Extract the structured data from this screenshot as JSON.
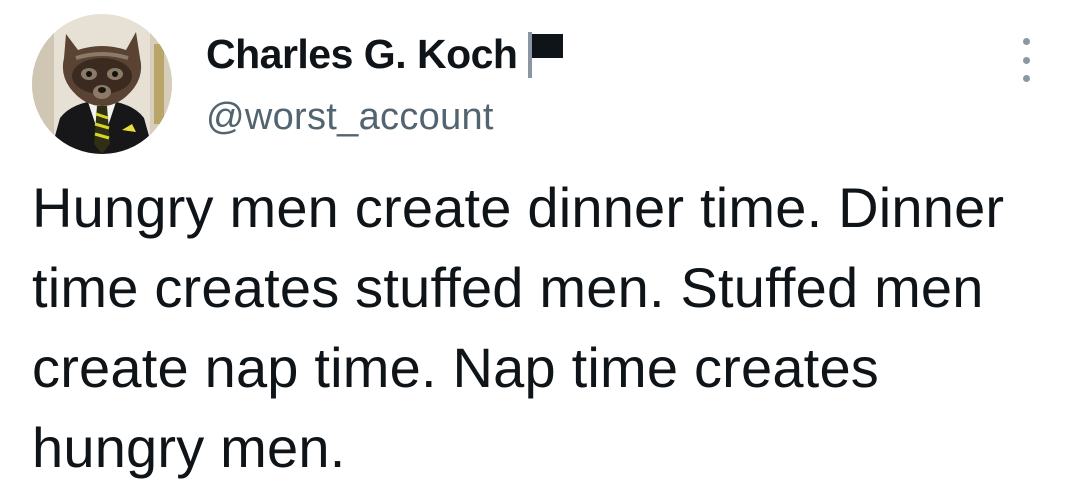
{
  "author": {
    "display_name": "Charles G. Koch",
    "handle": "@worst_account",
    "badge_icon": "black-flag-icon",
    "avatar_icon": "raccoon-in-suit-avatar"
  },
  "actions": {
    "more_icon": "more-options-icon"
  },
  "tweet": {
    "text": "Hungry men create dinner time. Dinner time creates stuffed men. Stuffed men create nap time. Nap time creates hungry men."
  },
  "colors": {
    "text_primary": "#0f1419",
    "text_secondary": "#536471",
    "icon_muted": "#8899a6",
    "background": "#ffffff"
  }
}
